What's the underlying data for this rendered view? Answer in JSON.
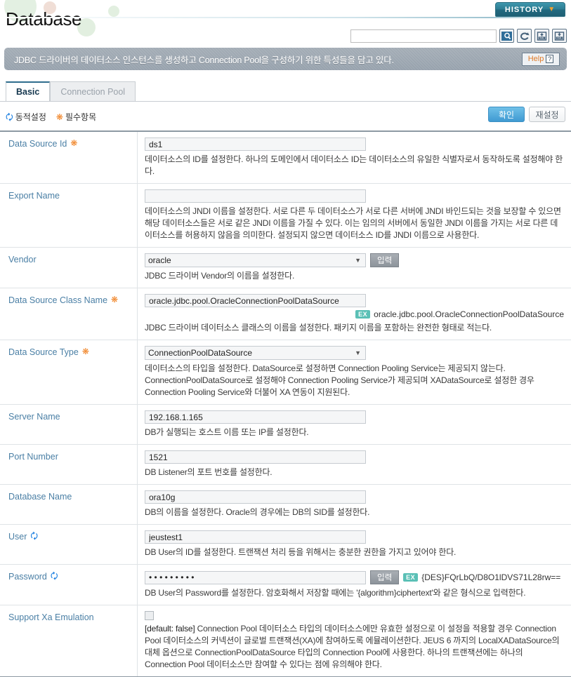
{
  "header": {
    "title": "Database",
    "history_label": "HISTORY",
    "history_caret": "chevron-down",
    "search_placeholder": "",
    "search_value": "",
    "icons": [
      {
        "name": "search-icon",
        "title": "Search"
      },
      {
        "name": "refresh-icon",
        "title": "Refresh"
      },
      {
        "name": "xml-import-icon",
        "title": "XML Import"
      },
      {
        "name": "xml-export-icon",
        "title": "XML Export"
      }
    ]
  },
  "banner": {
    "text": "JDBC 드라이버의 데이터소스 인스턴스를 생성하고 Connection Pool을 구성하기 위한 특성들을 담고 있다.",
    "help_label": "Help",
    "help_icon": "?"
  },
  "tabs": [
    {
      "label": "Basic",
      "active": true
    },
    {
      "label": "Connection Pool",
      "active": false
    }
  ],
  "legend": {
    "dynamic": "동적설정",
    "required": "필수항목"
  },
  "actions": {
    "confirm": "확인",
    "reset": "재설정"
  },
  "colors": {
    "accent_blue": "#3f9ad2",
    "label_blue": "#4a7fa5",
    "required_orange": "#f08020",
    "dynamic_blue": "#1a7ee0",
    "example_teal": "#5bc0b6",
    "banner_gray": "#a4adb6",
    "history_teal": "#2d7d93"
  },
  "form": {
    "rows": [
      {
        "label": "Data Source Id",
        "required": true,
        "dynamic": false,
        "control": "text",
        "value": "ds1",
        "desc": "데이터소스의 ID를 설정한다. 하나의 도메인에서 데이터소스 ID는 데이터소스의 유일한 식별자로서 동작하도록 설정해야 한다."
      },
      {
        "label": "Export Name",
        "required": false,
        "dynamic": false,
        "control": "text",
        "value": "",
        "desc": "데이터소스의 JNDI 이름을 설정한다. 서로 다른 두 데이터소스가 서로 다른 서버에 JNDI 바인드되는 것을 보장할 수 있으면 해당 데이터소스들은 서로 같은 JNDI 이름을 가질 수 있다. 이는 임의의 서버에서 동일한 JNDI 이름을 가지는 서로 다른 데이터소스를 허용하지 않음을 의미한다. 설정되지 않으면 데이터소스 ID를 JNDI 이름으로 사용한다."
      },
      {
        "label": "Vendor",
        "required": false,
        "dynamic": false,
        "control": "select-with-button",
        "value": "oracle",
        "button_label": "입력",
        "desc": "JDBC 드라이버 Vendor의 이름을 설정한다."
      },
      {
        "label": "Data Source Class Name",
        "required": true,
        "dynamic": false,
        "control": "text-with-example",
        "value": "oracle.jdbc.pool.OracleConnectionPoolDataSource",
        "example_badge": "EX",
        "example": "oracle.jdbc.pool.OracleConnectionPoolDataSource",
        "desc": "JDBC 드라이버 데이터소스 클래스의 이름을 설정한다. 패키지 이름을 포함하는 완전한 형태로 적는다."
      },
      {
        "label": "Data Source Type",
        "required": true,
        "dynamic": false,
        "control": "select",
        "value": "ConnectionPoolDataSource",
        "desc": "데이터소스의 타입을 설정한다. DataSource로 설정하면 Connection Pooling Service는 제공되지 않는다. ConnectionPoolDataSource로 설정해야 Connection Pooling Service가 제공되며 XADataSource로 설정한 경우 Connection Pooling Service와 더불어 XA 연동이 지원된다."
      },
      {
        "label": "Server Name",
        "required": false,
        "dynamic": false,
        "control": "text",
        "value": "192.168.1.165",
        "desc": "DB가 실행되는 호스트 이름 또는 IP를 설정한다."
      },
      {
        "label": "Port Number",
        "required": false,
        "dynamic": false,
        "control": "text",
        "value": "1521",
        "desc": "DB Listener의 포트 번호를 설정한다."
      },
      {
        "label": "Database Name",
        "required": false,
        "dynamic": false,
        "control": "text",
        "value": "ora10g",
        "desc": "DB의 이름을 설정한다. Oracle의 경우에는 DB의 SID를 설정한다."
      },
      {
        "label": "User",
        "required": false,
        "dynamic": true,
        "control": "text",
        "value": "jeustest1",
        "desc": "DB User의 ID를 설정한다. 트랜잭션 처리 등을 위해서는 충분한 권한을 가지고 있어야 한다."
      },
      {
        "label": "Password",
        "required": false,
        "dynamic": true,
        "control": "password-with-button-example",
        "value": "• • • • • • • • •",
        "button_label": "입력",
        "example_badge": "EX",
        "example": "{DES}FQrLbQ/D8O1lDVS71L28rw==",
        "desc": "DB User의 Password를 설정한다. 암호화해서 저장할 때에는 '{algorithm}ciphertext'와 같은 형식으로 입력한다."
      },
      {
        "label": "Support Xa Emulation",
        "required": false,
        "dynamic": false,
        "control": "checkbox",
        "checked": false,
        "default_tag": "[default: false]",
        "desc": "Connection Pool 데이터소스 타입의 데이터소스에만 유효한 설정으로 이 설정을 적용할 경우 Connection Pool 데이터소스의 커넥션이 글로벌 트랜잭션(XA)에 참여하도록 에뮬레이션한다. JEUS 6 까지의 LocalXADataSource의 대체 옵션으로 ConnectionPoolDataSource 타입의 Connection Pool에 사용한다. 하나의 트랜잭션에는 하나의 Connection Pool 데이터소스만 참여할 수 있다는 점에 유의해야 한다."
      }
    ]
  }
}
